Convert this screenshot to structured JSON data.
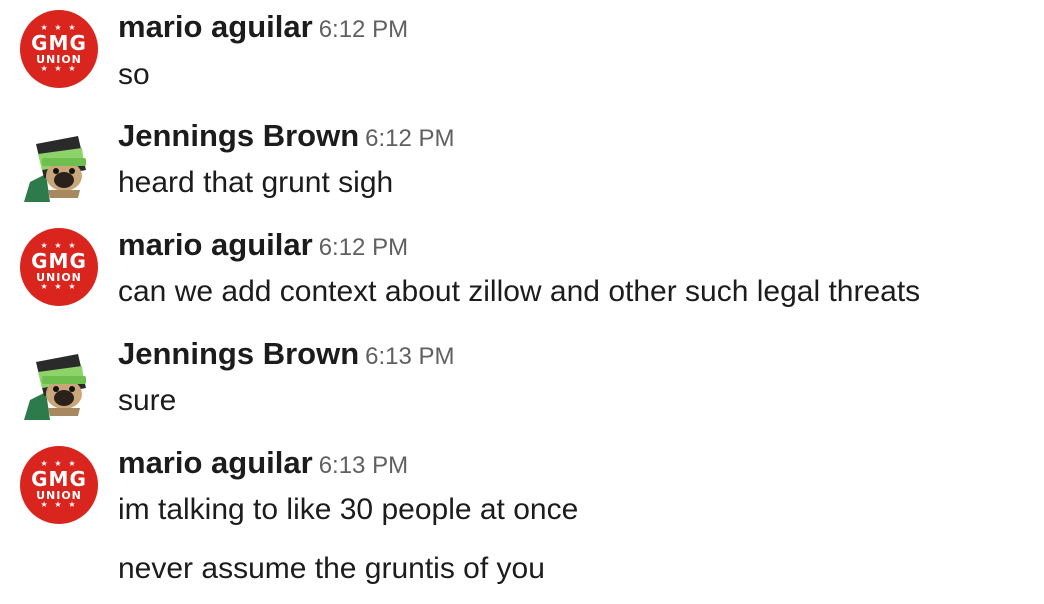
{
  "messages": [
    {
      "author": "mario aguilar",
      "time": "6:12 PM",
      "avatar": "gmg-union-icon",
      "lines": [
        "so"
      ]
    },
    {
      "author": "Jennings Brown",
      "time": "6:12 PM",
      "avatar": "pug-frankenstein-icon",
      "lines": [
        "heard that grunt sigh"
      ]
    },
    {
      "author": "mario aguilar",
      "time": "6:12 PM",
      "avatar": "gmg-union-icon",
      "lines": [
        "can we add context about zillow and other such legal threats"
      ]
    },
    {
      "author": "Jennings Brown",
      "time": "6:13 PM",
      "avatar": "pug-frankenstein-icon",
      "lines": [
        "sure"
      ]
    },
    {
      "author": "mario aguilar",
      "time": "6:13 PM",
      "avatar": "gmg-union-icon",
      "lines": [
        "im talking to like 30 people at once",
        "never assume the gruntis of you"
      ]
    }
  ],
  "gmg_logo": {
    "stars": "★ ★ ★",
    "top": "GMG",
    "bottom": "UNION",
    "bg_color": "#d9251d"
  },
  "colors": {
    "text": "#1d1c1d",
    "timestamp": "#616061"
  }
}
